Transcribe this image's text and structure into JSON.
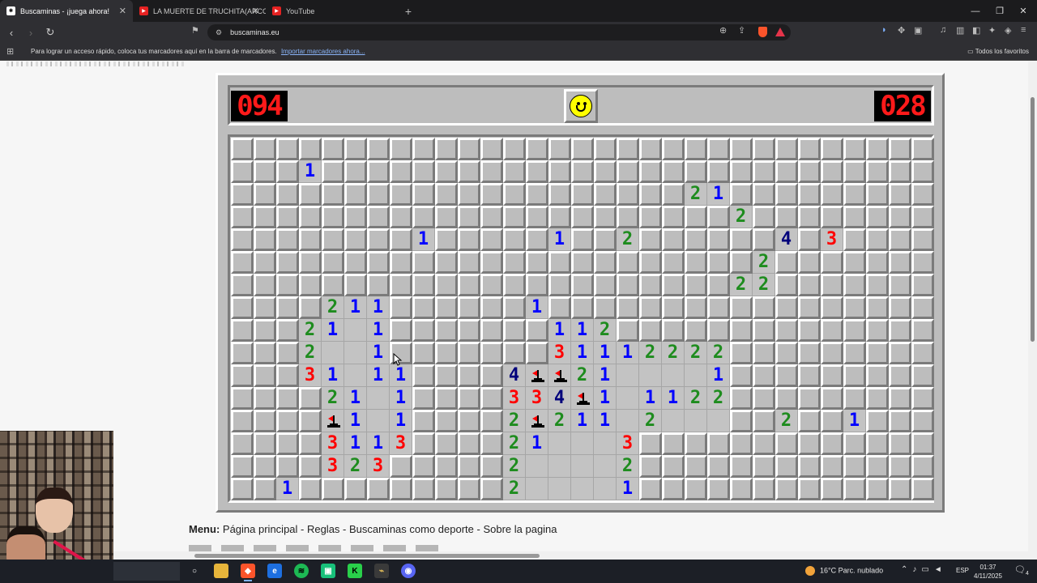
{
  "browser": {
    "tabs": [
      {
        "title": "Buscaminas - ¡juega ahora!",
        "active": true,
        "favicon": "minesweeper-icon"
      },
      {
        "title": "LA MUERTE DE TRUCHITA(ARCO DE",
        "active": false,
        "favicon": "youtube-icon"
      },
      {
        "title": "YouTube",
        "active": false,
        "favicon": "youtube-icon"
      }
    ],
    "new_tab": "+",
    "url": "buscaminas.eu",
    "bookmarks_message": "Para lograr un acceso rápido, coloca tus marcadores aquí en la barra de marcadores.",
    "bookmarks_import": "Importar marcadores ahora...",
    "all_bookmarks": "Todos los favoritos"
  },
  "game": {
    "mine_counter": "094",
    "timer": "028",
    "face": "smiley",
    "rows": [
      "...............................",
      "...1...........................",
      "...........................21..",
      "............................2..",
      "...............1.....1..2.....4.3..",
      "................................",
      "................................",
      "..."
    ]
  },
  "board_rows": [
    "###############################",
    "###1###########################",
    "#########################21####",
    "###########################2###",
    "#########1#####1##2########4#3##",
    "############################2##",
    "###########################22##",
    "####211#######1################",
    "###21_1#######112##############",
    "###2__1######3111222##########",
    "###31_11####4FF21___1#########",
    "####21_1####334F1_1122########",
    "####F1_1####2F211_2___2##1####",
    "####3113####21___3#############",
    "####323#####2____2#############",
    "##1#########2____1#############"
  ],
  "board_grid": [
    "CCCCCCCCCCCCCCCCCCCCCCCCCCCCCCC",
    "CCC1CCCCCCCCCCCCCCCCCCCCCCCCCCC",
    "CCCCCCCCCCCCCCCCCCCC21CCCCCCCCC",
    "CCCCCCCCCCCCCCCCCCCCCC2CCCCCCCC",
    "CCCCCCCC1CCCCC1CC2CCCCCC4C3CCCC",
    "CCCCCCCCCCCCCCCCCCCCCCC2CCCCCCC",
    "CCCCCCCCCCCCCCCCCCCCCC22CCCCCCC",
    "CCCC211CCCCCC1CCCCCCCCCCCCCCCCC",
    "CCC21_1CCCCCCC112CCCCCCCCCCCCCC",
    "CCC2__1CCCCCCC31112222CCCCCCCCC",
    "CCC31_11CCCC4FF21____1CCCCCCCCC",
    "CCCC21_1CCCC334F1_1122CCCCCCCCC",
    "CCCCF1_1CCCC2F211_2___CC2CC1CCC",
    "CCCC3113CCCC21___3CCCCCCCCCCCCC",
    "CCCC323CCCCC2____2CCCCCCCCCCCCC",
    "CC1CCCCCCCCC2____1CCCCCCCCCCCCC"
  ],
  "menu": {
    "label": "Menu:",
    "links": "Página principal - Reglas - Buscaminas como deporte - Sobre la pagina"
  },
  "taskbar": {
    "weather": "16°C  Parc. nublado",
    "lang": "ESP",
    "time": "01:37",
    "date": "4/11/2025",
    "notif_count": "4"
  },
  "colors": {
    "n1": "#0000ff",
    "n2": "#1e8c1e",
    "n3": "#ff0000",
    "n4": "#00007b",
    "lcd": "#ff1a1a",
    "cell": "#bdbdbd"
  }
}
